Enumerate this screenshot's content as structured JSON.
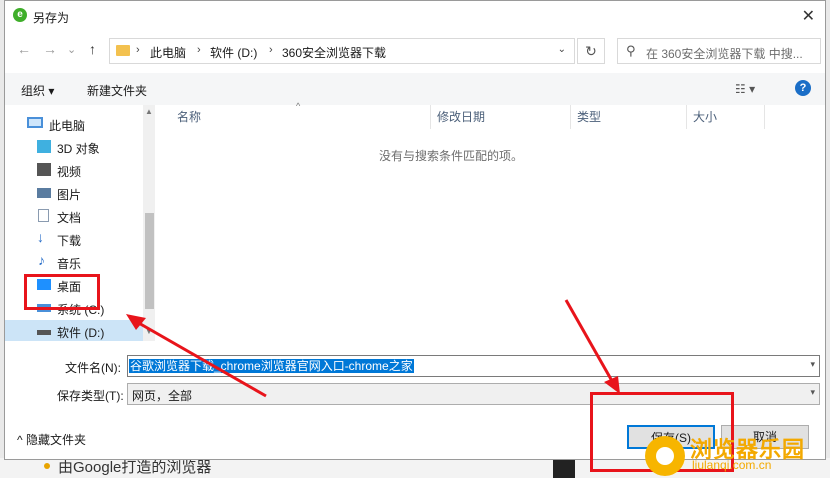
{
  "background": {
    "bottom_text": "由Google打造的浏览器"
  },
  "dialog": {
    "title": "另存为",
    "close_glyph": "✕"
  },
  "nav": {
    "back": "←",
    "forward": "→",
    "dropdown": "⌄",
    "up": "↑"
  },
  "address": {
    "crumbs": [
      "此电脑",
      "软件 (D:)",
      "360安全浏览器下载"
    ],
    "separator": "›",
    "dropdown": "⌄"
  },
  "refresh_glyph": "↻",
  "search": {
    "icon": "⚲",
    "placeholder": "在 360安全浏览器下载 中搜..."
  },
  "toolbar": {
    "organize": "组织 ▾",
    "new_folder": "新建文件夹",
    "view": "☷ ▾",
    "help": "?"
  },
  "sidebar": {
    "items": [
      {
        "label": "此电脑",
        "icon": "computer-icon",
        "color": "#4a90d9"
      },
      {
        "label": "3D 对象",
        "icon": "3d-objects-icon",
        "color": "#3fb0e0"
      },
      {
        "label": "视频",
        "icon": "video-icon",
        "color": "#555555"
      },
      {
        "label": "图片",
        "icon": "pictures-icon",
        "color": "#5a7ca0"
      },
      {
        "label": "文档",
        "icon": "documents-icon",
        "color": "#8a9bb0"
      },
      {
        "label": "下载",
        "icon": "downloads-icon",
        "color": "#2a6fc9"
      },
      {
        "label": "音乐",
        "icon": "music-icon",
        "color": "#2a6fc9"
      },
      {
        "label": "桌面",
        "icon": "desktop-icon",
        "color": "#1e90ff"
      },
      {
        "label": "系统 (C:)",
        "icon": "drive-c-icon",
        "color": "#4a90d9"
      },
      {
        "label": "软件 (D:)",
        "icon": "drive-d-icon",
        "color": "#555555"
      }
    ]
  },
  "file_list": {
    "columns": [
      "名称",
      "修改日期",
      "类型",
      "大小"
    ],
    "sort_caret": "^",
    "empty_message": "没有与搜索条件匹配的项。"
  },
  "filename": {
    "label": "文件名(N):",
    "value": "谷歌浏览器下载_chrome浏览器官网入口-chrome之家"
  },
  "filetype": {
    "label": "保存类型(T):",
    "value": "网页，全部"
  },
  "footer": {
    "hide_folders": "^ 隐藏文件夹",
    "save": "保存(S)",
    "cancel": "取消"
  },
  "watermark": {
    "title": "浏览器乐园",
    "subtitle": "liulanqi.com.cn"
  },
  "colors": {
    "accent": "#0078d7",
    "annotation": "#e8141b",
    "watermark": "#f3a900"
  }
}
